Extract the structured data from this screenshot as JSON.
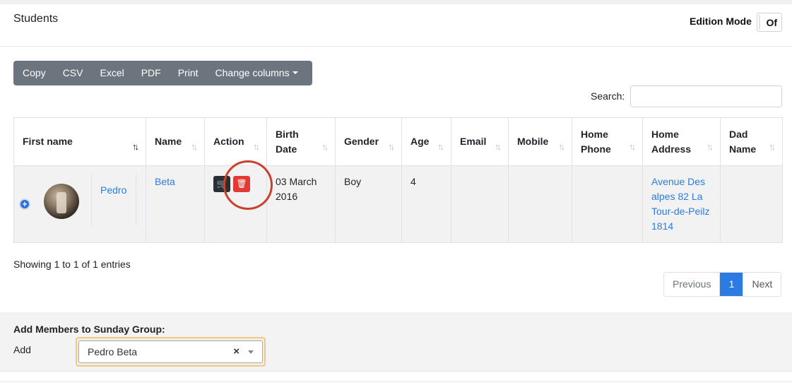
{
  "header": {
    "title": "Students",
    "edition_mode_label": "Edition Mode",
    "toggle_value": "Of"
  },
  "toolbar": {
    "buttons": [
      "Copy",
      "CSV",
      "Excel",
      "PDF",
      "Print"
    ],
    "change_columns": "Change columns"
  },
  "search": {
    "label": "Search:",
    "value": ""
  },
  "table": {
    "columns": [
      {
        "label": "First name",
        "sorted": true
      },
      {
        "label": "Name"
      },
      {
        "label": "Action"
      },
      {
        "label": "Birth Date"
      },
      {
        "label": "Gender"
      },
      {
        "label": "Age"
      },
      {
        "label": "Email"
      },
      {
        "label": "Mobile"
      },
      {
        "label": "Home Phone"
      },
      {
        "label": "Home Address"
      },
      {
        "label": "Dad Name"
      }
    ],
    "rows": [
      {
        "first_name": "Pedro",
        "name": "Beta",
        "birth_date": "03 March 2016",
        "gender": "Boy",
        "age": "4",
        "email": "",
        "mobile": "",
        "home_phone": "",
        "home_address": "Avenue Des alpes 82 La Tour-de-Peilz 1814",
        "dad_name": ""
      }
    ]
  },
  "info": "Showing 1 to 1 of 1 entries",
  "pagination": {
    "previous": "Previous",
    "current": "1",
    "next": "Next"
  },
  "footer": {
    "title": "Add Members to Sunday Group:",
    "add_label": "Add",
    "selected": "Pedro Beta",
    "clear_symbol": "×"
  },
  "icons": {
    "expand": "plus-circle-icon",
    "cart": "cart-icon",
    "delete": "trash-icon",
    "sort": "sort-icon"
  },
  "colors": {
    "link": "#2a7ce0",
    "primary": "#2b7be3",
    "danger": "#e53935",
    "toolbar": "#6c757d"
  }
}
